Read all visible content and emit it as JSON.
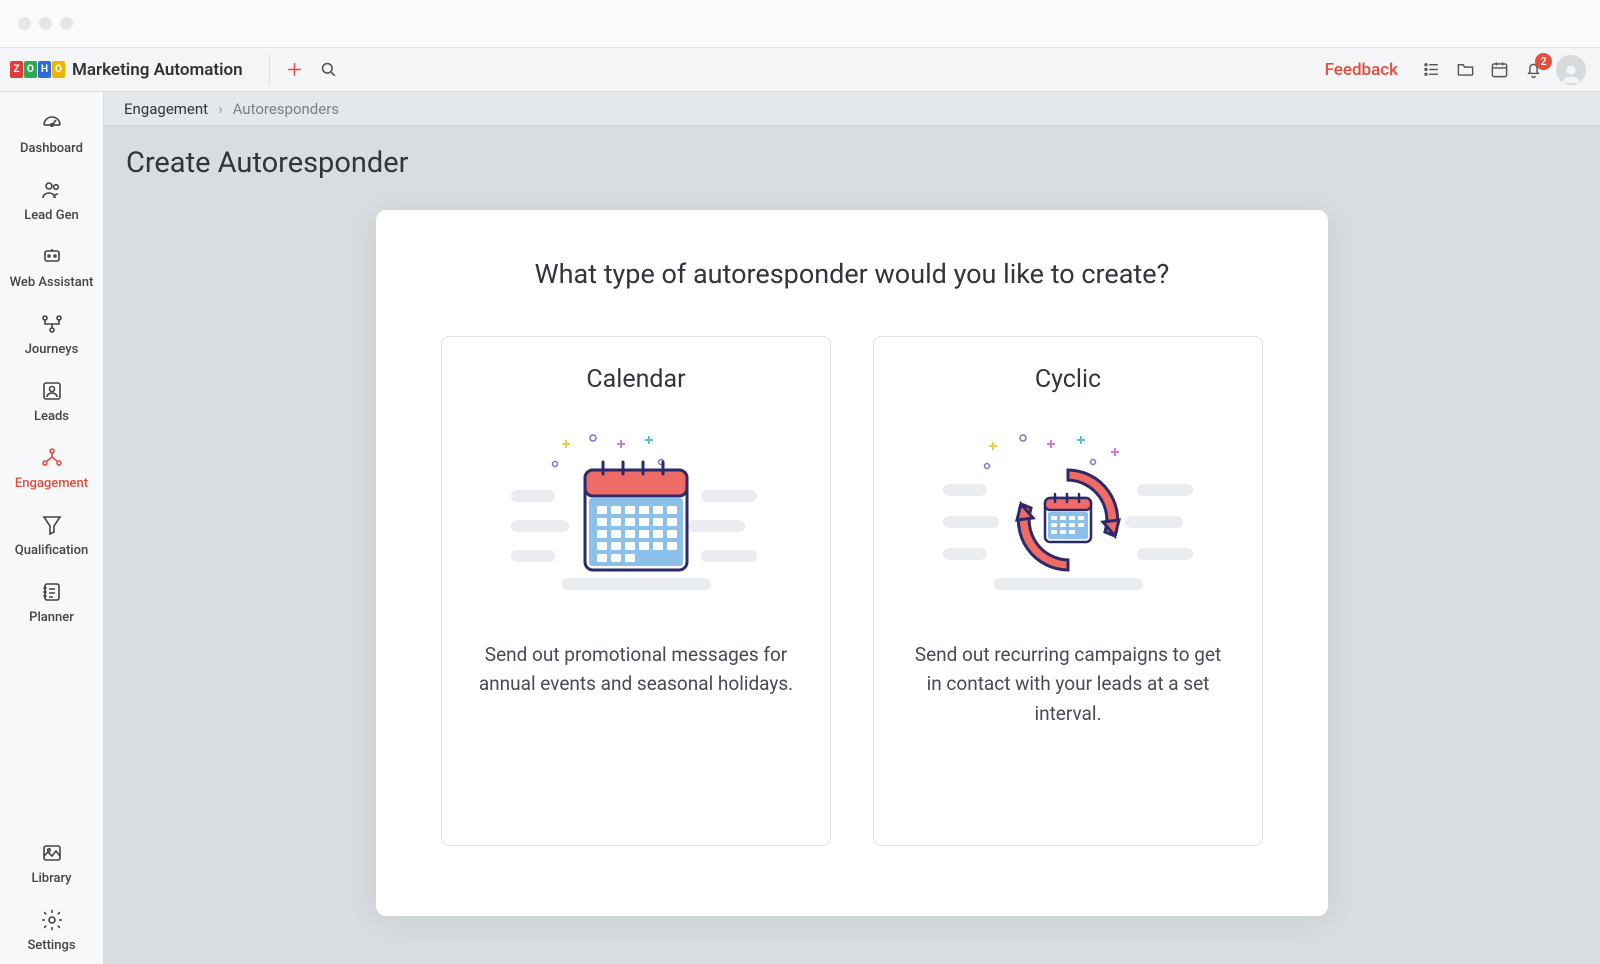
{
  "app": {
    "name": "Marketing Automation",
    "logo_letters": [
      "Z",
      "O",
      "H",
      "O"
    ]
  },
  "topbar": {
    "feedback_label": "Feedback",
    "notification_count": "2"
  },
  "sidebar": {
    "items": [
      {
        "label": "Dashboard",
        "icon": "dashboard-icon"
      },
      {
        "label": "Lead Gen",
        "icon": "leadgen-icon"
      },
      {
        "label": "Web Assistant",
        "icon": "webassistant-icon"
      },
      {
        "label": "Journeys",
        "icon": "journeys-icon"
      },
      {
        "label": "Leads",
        "icon": "leads-icon"
      },
      {
        "label": "Engagement",
        "icon": "engagement-icon",
        "active": true
      },
      {
        "label": "Qualification",
        "icon": "qualification-icon"
      },
      {
        "label": "Planner",
        "icon": "planner-icon"
      }
    ],
    "bottom_items": [
      {
        "label": "Library",
        "icon": "library-icon"
      },
      {
        "label": "Settings",
        "icon": "settings-icon"
      }
    ]
  },
  "breadcrumb": {
    "parent": "Engagement",
    "current": "Autoresponders"
  },
  "page": {
    "title": "Create Autoresponder"
  },
  "panel": {
    "question": "What type of autoresponder would you like to create?",
    "options": [
      {
        "title": "Calendar",
        "description": "Send out promotional messages for annual events and seasonal holidays."
      },
      {
        "title": "Cyclic",
        "description": "Send out recurring campaigns to get in contact with your leads at a set interval."
      }
    ]
  },
  "colors": {
    "accent": "#e74c3c",
    "illus_red": "#ef6b65",
    "illus_blue": "#8bc0ea",
    "illus_stroke": "#2b2a6a"
  }
}
